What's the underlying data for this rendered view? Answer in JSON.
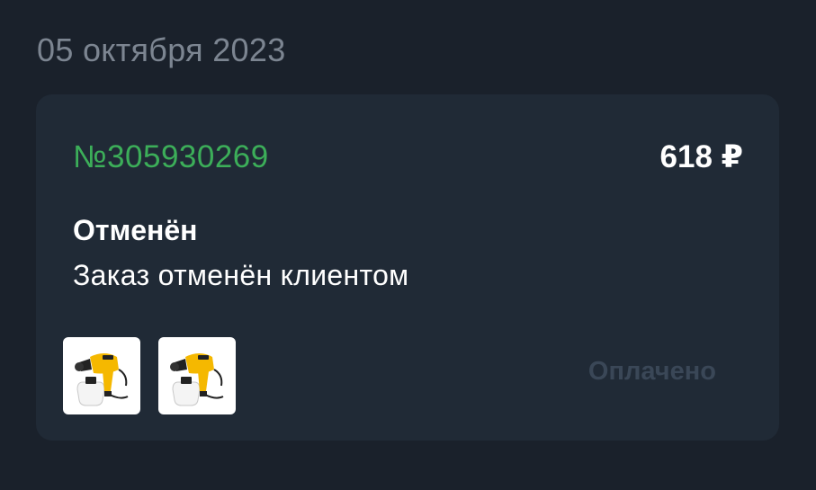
{
  "date_header": "05 октября 2023",
  "order": {
    "number": "№305930269",
    "price": "618 ₽",
    "status_title": "Отменён",
    "status_description": "Заказ отменён клиентом",
    "payment_status": "Оплачено",
    "products": [
      {
        "icon": "paint-sprayer-icon"
      },
      {
        "icon": "paint-sprayer-icon"
      }
    ]
  },
  "colors": {
    "background": "#1a212b",
    "card": "#202a36",
    "order_number": "#3cae59",
    "date_text": "#7c8591",
    "payment_status": "#3a4757",
    "product_yellow": "#f5b800"
  }
}
